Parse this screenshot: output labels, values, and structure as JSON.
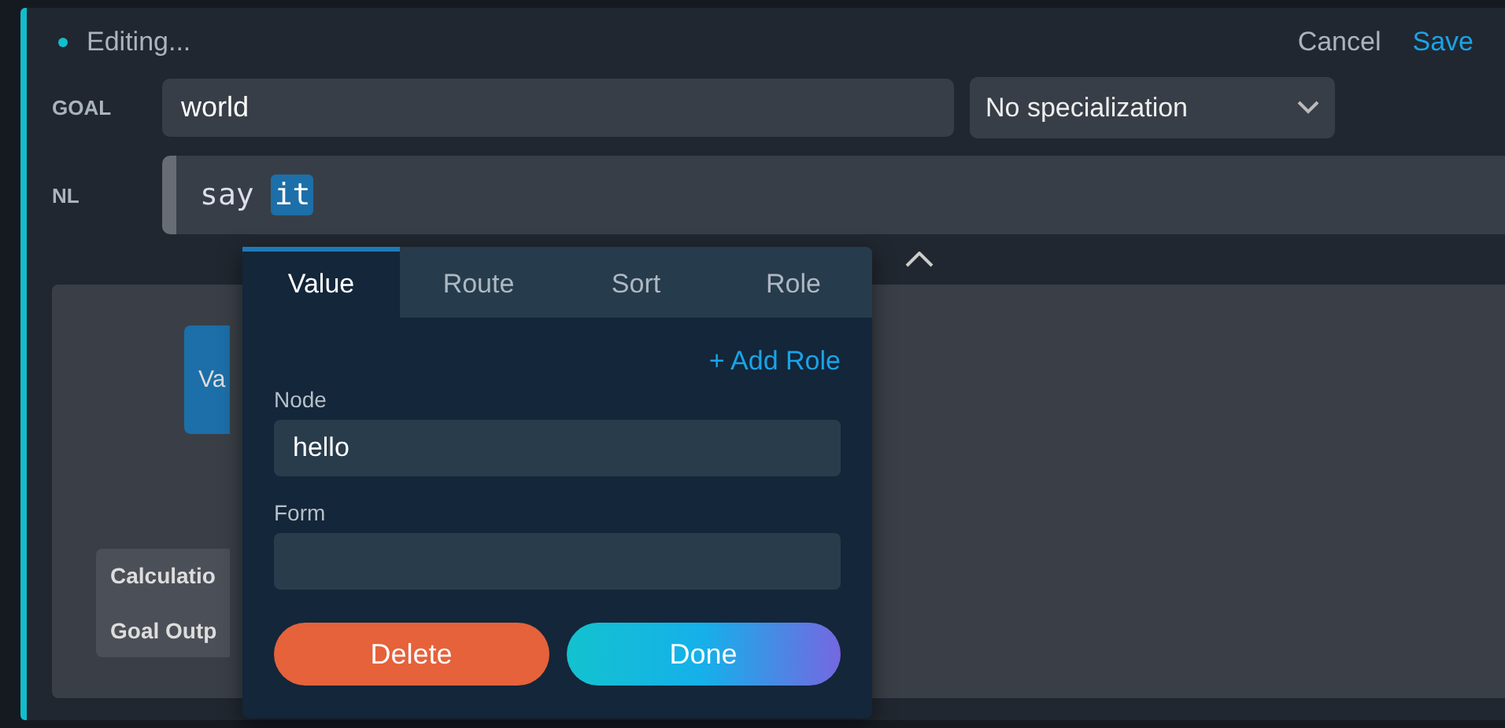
{
  "header": {
    "status": "Editing...",
    "actions": [
      {
        "label": "Cancel",
        "kind": "secondary"
      },
      {
        "label": "Save",
        "kind": "primary"
      }
    ]
  },
  "goal": {
    "label": "GOAL",
    "value": "world",
    "specialization": "No specialization"
  },
  "nl": {
    "label": "NL",
    "words": [
      {
        "text": "say",
        "selected": false
      },
      {
        "text": "it",
        "selected": true
      }
    ]
  },
  "canvas": {
    "node": "Va",
    "outputs": [
      "Calculatio",
      "Goal Outp"
    ]
  },
  "popup": {
    "tabs": [
      {
        "label": "Value",
        "selected": true
      },
      {
        "label": "Route",
        "selected": false
      },
      {
        "label": "Sort",
        "selected": false
      },
      {
        "label": "Role",
        "selected": false
      }
    ],
    "add_role": "+ Add Role",
    "fields": [
      {
        "label": "Node",
        "value": "hello"
      },
      {
        "label": "Form"
      }
    ],
    "buttons": [
      {
        "label": "Delete",
        "kind": "danger"
      },
      {
        "label": "Done",
        "kind": "primary"
      }
    ]
  }
}
